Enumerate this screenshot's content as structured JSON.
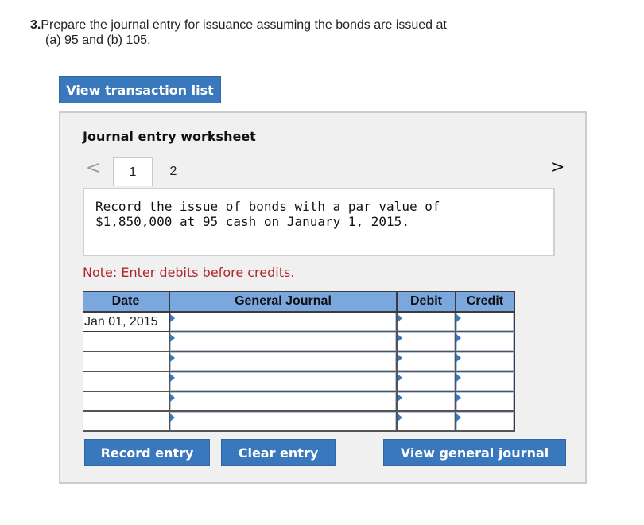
{
  "question": {
    "number": "3.",
    "line1": "Prepare the journal entry for issuance assuming the bonds are issued at",
    "line2": "(a) 95 and (b) 105."
  },
  "buttons": {
    "view_transaction_list": "View transaction list",
    "record_entry": "Record entry",
    "clear_entry": "Clear entry",
    "view_general_journal": "View general journal"
  },
  "worksheet": {
    "title": "Journal entry worksheet",
    "nav_prev": "<",
    "nav_next": ">",
    "tabs": [
      "1",
      "2"
    ],
    "description": "Record the issue of bonds with a par value of\n$1,850,000 at 95 cash on January 1, 2015.",
    "note": "Note: Enter debits before credits."
  },
  "journal": {
    "headers": {
      "date": "Date",
      "general_journal": "General Journal",
      "debit": "Debit",
      "credit": "Credit"
    },
    "rows": [
      {
        "date": "Jan 01, 2015",
        "account": "",
        "debit": "",
        "credit": ""
      },
      {
        "date": "",
        "account": "",
        "debit": "",
        "credit": ""
      },
      {
        "date": "",
        "account": "",
        "debit": "",
        "credit": ""
      },
      {
        "date": "",
        "account": "",
        "debit": "",
        "credit": ""
      },
      {
        "date": "",
        "account": "",
        "debit": "",
        "credit": ""
      },
      {
        "date": "",
        "account": "",
        "debit": "",
        "credit": ""
      }
    ]
  },
  "colors": {
    "button_blue": "#3a78bd",
    "header_blue": "#7aa7de",
    "note_red": "#b0242b",
    "panel_gray": "#f0f0f0"
  }
}
